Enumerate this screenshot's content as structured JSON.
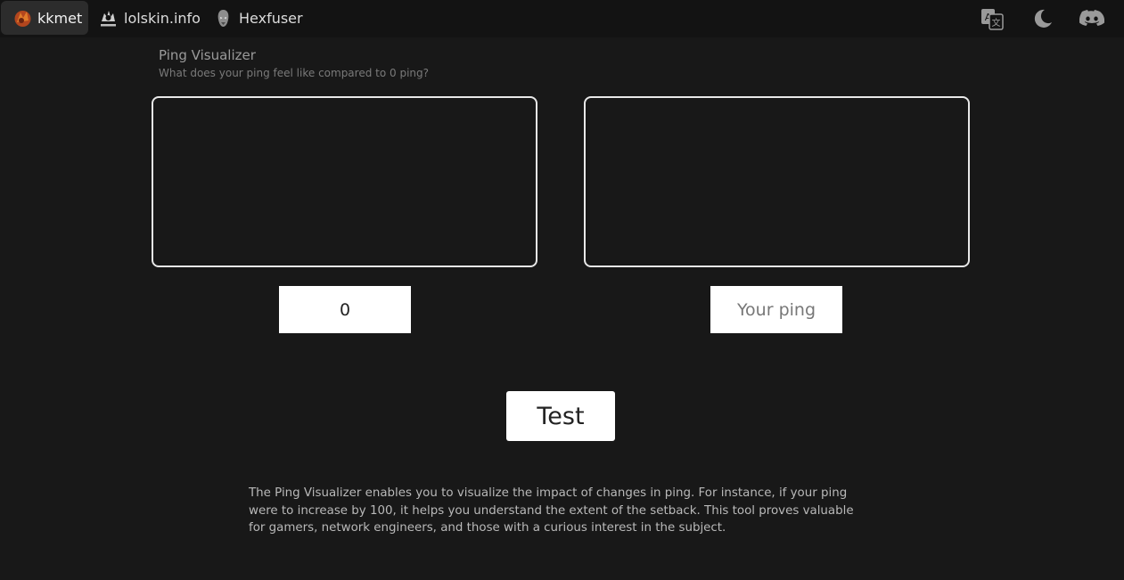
{
  "nav": {
    "items": [
      {
        "label": "kkmet",
        "icon": "kkmet-logo-icon"
      },
      {
        "label": "lolskin.info",
        "icon": "lolskin-logo-icon"
      },
      {
        "label": "Hexfuser",
        "icon": "hexfuser-logo-icon"
      }
    ],
    "tools": [
      {
        "icon": "translate-icon"
      },
      {
        "icon": "moon-icon"
      },
      {
        "icon": "discord-icon"
      }
    ]
  },
  "page": {
    "title": "Ping Visualizer",
    "subtitle": "What does your ping feel like compared to 0 ping?"
  },
  "left_panel": {
    "value": "0"
  },
  "right_panel": {
    "placeholder": "Your ping",
    "value": ""
  },
  "test_button": {
    "label": "Test"
  },
  "description": "The Ping Visualizer enables you to visualize the impact of changes in ping. For instance, if your ping were to increase by 100, it helps you understand the extent of the setback. This tool proves valuable for gamers, network engineers, and those with a curious interest in the subject.",
  "colors": {
    "background": "#181818",
    "navbar": "#131313",
    "active_nav": "#2c2c2c",
    "box_border": "#e8e8e8",
    "button": "#ffffff"
  }
}
